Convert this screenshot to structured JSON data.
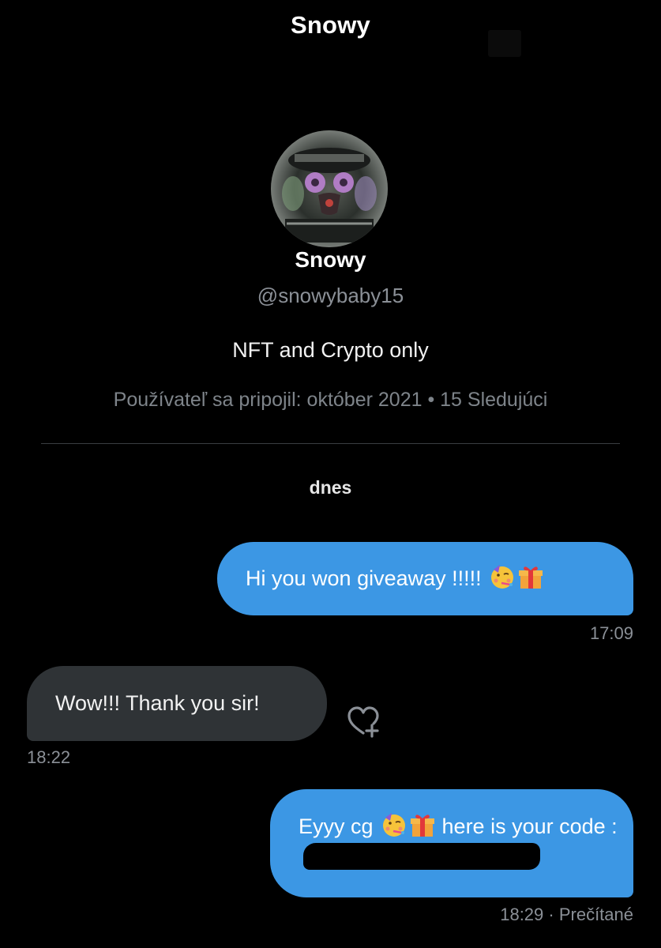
{
  "header": {
    "title": "Snowy"
  },
  "profile": {
    "name": "Snowy",
    "handle": "@snowybaby15",
    "bio": "NFT and Crypto only",
    "meta": "Používateľ sa pripojil: október 2021 • 15 Sledujúci"
  },
  "day_label": "dnes",
  "messages": [
    {
      "text": "Hi you won giveaway !!!!! ",
      "time": "17:09"
    },
    {
      "text": "Wow!!! Thank you sir!",
      "time": "18:22"
    },
    {
      "text_before": "Eyyy cg ",
      "text_after": " here is your code :",
      "time": "18:29",
      "status": " · Prečítané"
    }
  ],
  "icons": {
    "react": "heart-plus-icon",
    "party": "partying-face-emoji",
    "gift": "wrapped-gift-emoji"
  },
  "colors": {
    "sent_bubble": "#3c97e4",
    "received_bubble": "#2f3336",
    "muted_text": "#8b9097"
  }
}
